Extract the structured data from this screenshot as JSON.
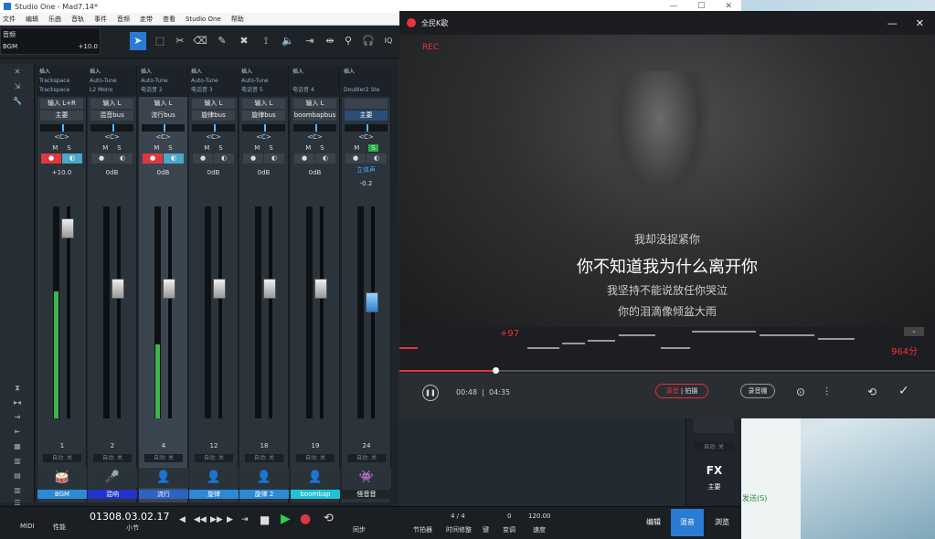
{
  "studio": {
    "title": "Studio One - Mad7.14*",
    "menu": [
      "文件",
      "编辑",
      "乐曲",
      "音轨",
      "事件",
      "音频",
      "走带",
      "查看",
      "Studio One",
      "帮助"
    ],
    "track_label": "音频",
    "track_name": "BGM",
    "track_vol": "+10.0"
  },
  "mixer": {
    "channels": [
      {
        "inserts": [
          "插入",
          "Trackspace",
          "Trackspace"
        ],
        "input": "输入 L+R",
        "output": "主要",
        "pan": "<C>",
        "vol": "+10.0",
        "num": "1",
        "auto": "自动: 关",
        "icon": "🥁",
        "name": "BGM",
        "color": "#2b89d6",
        "rec": true,
        "mon": true,
        "level": 0.6,
        "fader": 0.92
      },
      {
        "inserts": [
          "插入",
          "Auto-Tune",
          "L2 Mono"
        ],
        "input": "输入 L",
        "output": "混音bus",
        "pan": "<C>",
        "vol": "0dB",
        "num": "2",
        "auto": "自动: 关",
        "icon": "🎤",
        "name": "混响",
        "color": "#2233cc",
        "rec": false,
        "mon": false,
        "level": 0,
        "fader": 0.62
      },
      {
        "inserts": [
          "插入",
          "Auto-Tune",
          "电话音 2"
        ],
        "input": "输入 L",
        "output": "流行bus",
        "pan": "<C>",
        "vol": "0dB",
        "num": "4",
        "auto": "自动: 关",
        "icon": "👤",
        "name": "流行",
        "color": "#2f62c4",
        "rec": true,
        "mon": true,
        "level": 0.35,
        "fader": 0.62
      },
      {
        "inserts": [
          "插入",
          "Auto-Tune",
          "电话音 3"
        ],
        "input": "输入 L",
        "output": "旋律bus",
        "pan": "<C>",
        "vol": "0dB",
        "num": "12",
        "auto": "自动: 关",
        "icon": "👤",
        "name": "旋律",
        "color": "#2b89d6",
        "rec": false,
        "mon": false,
        "level": 0,
        "fader": 0.62
      },
      {
        "inserts": [
          "插入",
          "Auto-Tune",
          "电话音 5"
        ],
        "input": "输入 L",
        "output": "旋律bus",
        "pan": "<C>",
        "vol": "0dB",
        "num": "18",
        "auto": "自动: 关",
        "icon": "👤",
        "name": "旋律 2",
        "color": "#2b89d6",
        "rec": false,
        "mon": false,
        "level": 0,
        "fader": 0.62
      },
      {
        "inserts": [
          "插入",
          "",
          "电话音 4"
        ],
        "input": "输入 L",
        "output": "boombapbus",
        "pan": "<C>",
        "vol": "0dB",
        "num": "19",
        "auto": "自动: 关",
        "icon": "👤",
        "name": "boombap",
        "color": "#1ec4d6",
        "rec": false,
        "mon": false,
        "level": 0,
        "fader": 0.62
      },
      {
        "inserts": [
          "插入",
          "",
          "Doubler2 Ste"
        ],
        "input": "",
        "output": "主要",
        "pan": "<C>",
        "vol": "-0.2",
        "num": "24",
        "auto": "自动: 关",
        "icon": "👾",
        "name": "怪音音",
        "color": "#1f2528",
        "rec": false,
        "mon": false,
        "level": 0,
        "fader": 0.55,
        "stereo": "立体声",
        "fx": true
      }
    ],
    "fx_label": "FX",
    "fx_sublabel": "FX",
    "main_label": "主要"
  },
  "transport": {
    "midi": "MIDI",
    "perf": "性能",
    "time": "01308.03.02.17",
    "time_unit": "小节",
    "sync": "同步",
    "metronome": "节拍器",
    "signature": "4 / 4",
    "sig_label": "时间修整",
    "key": "键",
    "transpose": "0",
    "transpose_label": "变调",
    "tempo": "120.00",
    "tempo_label": "速度",
    "tab_edit": "编辑",
    "tab_mix": "混音",
    "tab_browse": "浏览"
  },
  "karaoke": {
    "title": "全民K歌",
    "rec": "REC",
    "lyric_prev": "我却没捉紧你",
    "lyric_current": "你不知道我为什么离开你",
    "lyric_next1": "我坚持不能说放任你哭泣",
    "lyric_next2": "你的泪滴像倾盆大雨",
    "score_delta": "+97",
    "score": "964分",
    "time_current": "00:48",
    "time_total": "04:35",
    "btn_record": "录音",
    "btn_shoot": "拍摄",
    "btn_effects": "录音棚",
    "progress": 0.18
  },
  "overlay": {
    "send_label": "发送(S)"
  }
}
